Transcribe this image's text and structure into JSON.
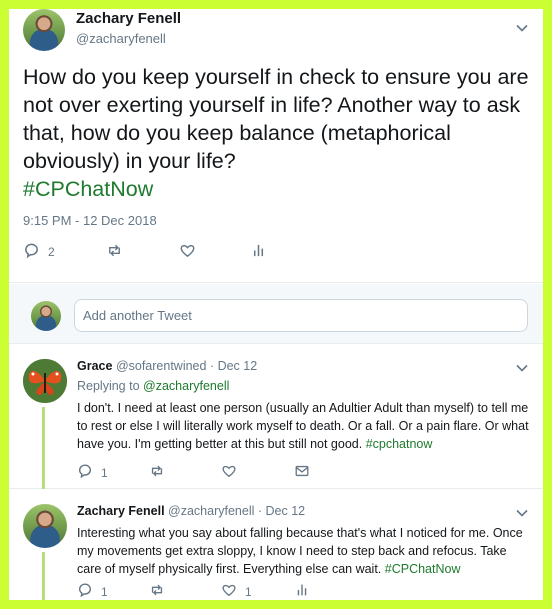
{
  "main_tweet": {
    "author_name": "Zachary Fenell",
    "author_handle": "@zacharyfenell",
    "text_line1": "How do you keep yourself in check to ensure you are not over exerting yourself in life? Another way to ask that, how do you keep balance (metaphorical obviously) in your life?",
    "hashtag": "#CPChatNow",
    "timestamp": "9:15 PM - 12 Dec 2018",
    "reply_count": "2",
    "icons": [
      "reply-icon",
      "retweet-icon",
      "like-icon",
      "analytics-icon",
      "chevron-down-icon"
    ]
  },
  "reply_box": {
    "placeholder": "Add another Tweet"
  },
  "replies": [
    {
      "name": "Grace",
      "handle": "@sofarentwined",
      "date": "· Dec 12",
      "replying_label": "Replying to",
      "replying_to": "@zacharyfenell",
      "text": "I don't. I need at least one person (usually an Adultier Adult than myself) to tell me to rest or else I will literally work myself to death. Or a fall. Or a pain flare. Or what have you. I'm getting better at this but still not good.",
      "hashtag": "#cpchatnow",
      "reply_count": "1"
    },
    {
      "name": "Zachary Fenell",
      "handle": "@zacharyfenell",
      "date": "· Dec 12",
      "text": "Interesting what you say about falling because that's what I noticed for me. Once my movements get extra sloppy, I know I need to step back and refocus. Take care of myself physically first. Everything else can wait.",
      "hashtag": "#CPChatNow",
      "reply_count": "1",
      "like_count": "1"
    }
  ],
  "colors": {
    "background": "#ccff33",
    "hashtag": "#1e7a2e",
    "muted": "#657786",
    "thread_line": "#b8e07a"
  }
}
